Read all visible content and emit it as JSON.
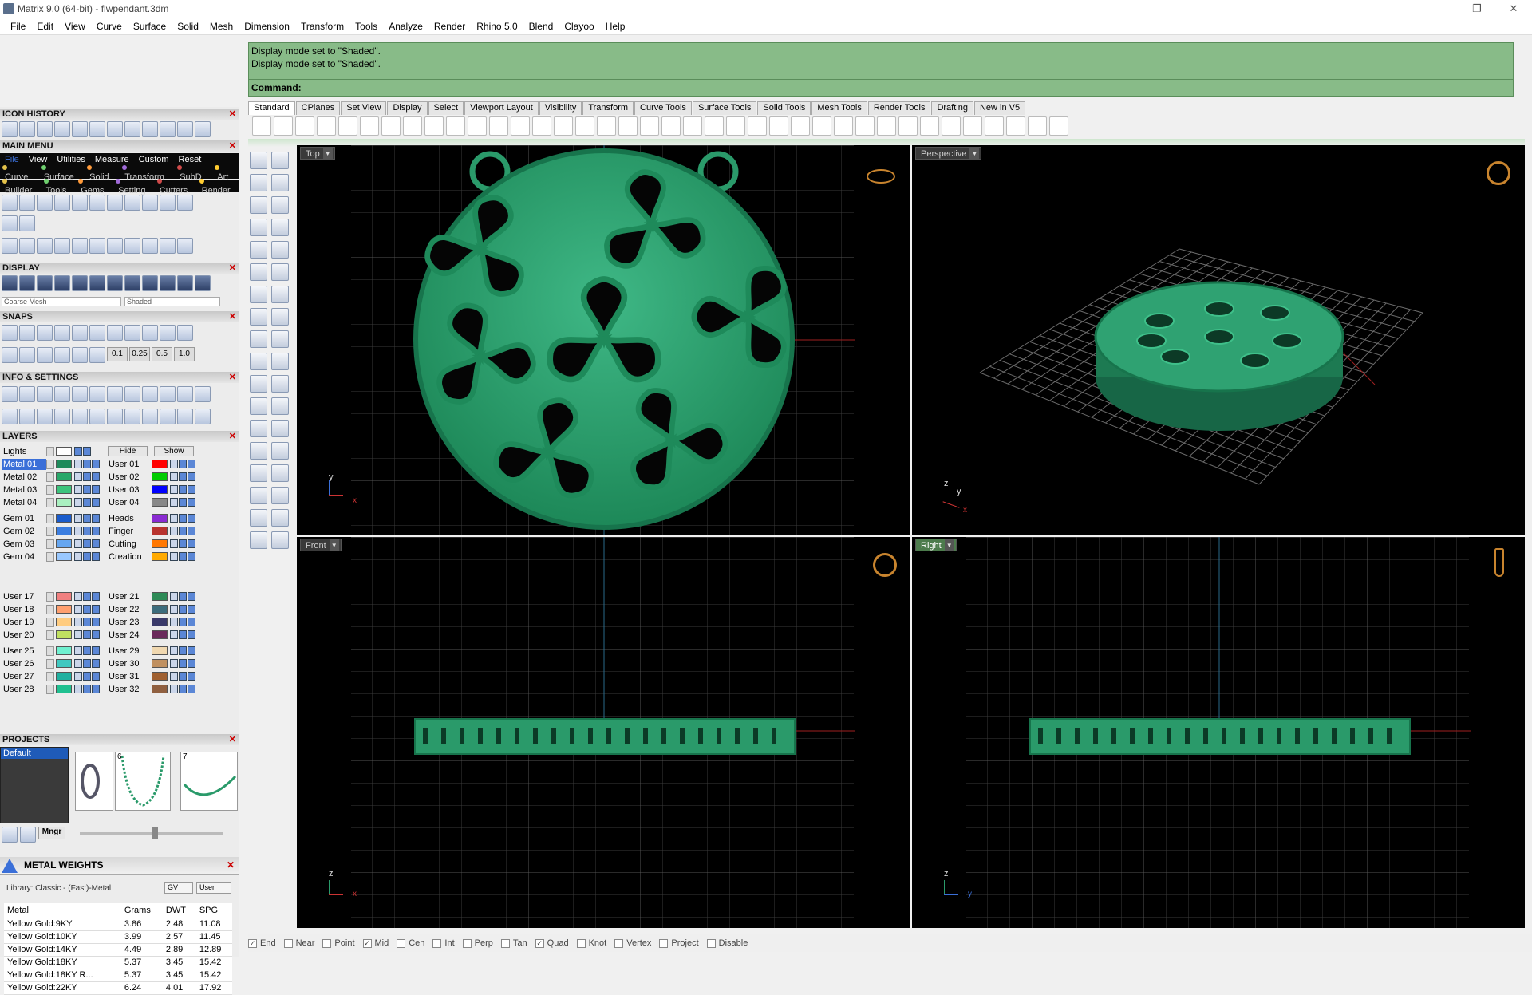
{
  "window": {
    "title": "Matrix 9.0 (64-bit) - flwpendant.3dm",
    "controls": [
      "—",
      "❐",
      "✕"
    ]
  },
  "menu": [
    "File",
    "Edit",
    "View",
    "Curve",
    "Surface",
    "Solid",
    "Mesh",
    "Dimension",
    "Transform",
    "Tools",
    "Analyze",
    "Render",
    "Rhino 5.0",
    "Blend",
    "Clayoo",
    "Help"
  ],
  "command": {
    "history": [
      "Display mode set to \"Shaded\".",
      "Display mode set to \"Shaded\"."
    ],
    "prompt": "Command:"
  },
  "toolbar_tabs": [
    "Standard",
    "CPlanes",
    "Set View",
    "Display",
    "Select",
    "Viewport Layout",
    "Visibility",
    "Transform",
    "Curve Tools",
    "Surface Tools",
    "Solid Tools",
    "Mesh Tools",
    "Render Tools",
    "Drafting",
    "New in V5"
  ],
  "panels": {
    "icon_history": "ICON HISTORY",
    "main_menu": "MAIN MENU",
    "main_menu_tabs": [
      "File",
      "View",
      "Utilities",
      "Measure",
      "Custom",
      "Reset"
    ],
    "main_menu_row1": [
      "Curve",
      "Surface",
      "Solid",
      "Transform",
      "SubD",
      "Art"
    ],
    "main_menu_row2": [
      "Builder",
      "Tools",
      "Gems",
      "Setting",
      "Cutters",
      "Render"
    ],
    "display": "DISPLAY",
    "display_mesh": "Coarse Mesh",
    "display_mode": "Shaded",
    "snaps": "SNAPS",
    "snap_values": [
      "0.1",
      "0.25",
      "0.5",
      "1.0"
    ],
    "info_settings": "INFO & SETTINGS",
    "layers": "LAYERS",
    "lights": "Lights",
    "hide": "Hide",
    "show": "Show",
    "projects": "PROJECTS",
    "project_default": "Default",
    "project_nums": [
      "6",
      "7"
    ],
    "mngr": "Mngr",
    "metal_weights": "METAL WEIGHTS",
    "library": "Library: Classic - (Fast)-Metal",
    "gv": "GV",
    "user": "User"
  },
  "layers": [
    {
      "l": "Metal 01",
      "lc": "#1e8a5a",
      "r": "User 01",
      "rc": "#ff0000",
      "sel": true
    },
    {
      "l": "Metal 02",
      "lc": "#28a86a",
      "r": "User 02",
      "rc": "#00cc00"
    },
    {
      "l": "Metal 03",
      "lc": "#3cc47c",
      "r": "User 03",
      "rc": "#0000ff"
    },
    {
      "l": "Metal 04",
      "lc": "#aaf0c0",
      "r": "User 04",
      "rc": "#888888"
    },
    {
      "l": "Gem 01",
      "lc": "#1a5ccc",
      "r": "Heads",
      "rc": "#8a2bd2"
    },
    {
      "l": "Gem 02",
      "lc": "#3c7ee0",
      "r": "Finger",
      "rc": "#b8332e"
    },
    {
      "l": "Gem 03",
      "lc": "#66a6f0",
      "r": "Cutting",
      "rc": "#ff7700"
    },
    {
      "l": "Gem 04",
      "lc": "#99c8ff",
      "r": "Creation",
      "rc": "#ffaa00"
    },
    {
      "l": "User 17",
      "lc": "#f08080",
      "r": "User 21",
      "rc": "#2e8b57"
    },
    {
      "l": "User 18",
      "lc": "#ffa070",
      "r": "User 22",
      "rc": "#3c6c7c"
    },
    {
      "l": "User 19",
      "lc": "#ffcc80",
      "r": "User 23",
      "rc": "#3a3a6a"
    },
    {
      "l": "User 20",
      "lc": "#c0e060",
      "r": "User 24",
      "rc": "#6a2a5a"
    },
    {
      "l": "User 25",
      "lc": "#70f0d0",
      "r": "User 29",
      "rc": "#f0d8b0"
    },
    {
      "l": "User 26",
      "lc": "#40c8c0",
      "r": "User 30",
      "rc": "#c09060"
    },
    {
      "l": "User 27",
      "lc": "#20b0a0",
      "r": "User 31",
      "rc": "#a06030"
    },
    {
      "l": "User 28",
      "lc": "#20c090",
      "r": "User 32",
      "rc": "#906040"
    }
  ],
  "metal_table": {
    "headers": [
      "Metal",
      "Grams",
      "DWT",
      "SPG"
    ],
    "rows": [
      [
        "Yellow Gold:9KY",
        "3.86",
        "2.48",
        "11.08"
      ],
      [
        "Yellow Gold:10KY",
        "3.99",
        "2.57",
        "11.45"
      ],
      [
        "Yellow Gold:14KY",
        "4.49",
        "2.89",
        "12.89"
      ],
      [
        "Yellow Gold:18KY",
        "5.37",
        "3.45",
        "15.42"
      ],
      [
        "Yellow Gold:18KY R...",
        "5.37",
        "3.45",
        "15.42"
      ],
      [
        "Yellow Gold:22KY",
        "6.24",
        "4.01",
        "17.92"
      ]
    ]
  },
  "viewports": {
    "top": "Top",
    "perspective": "Perspective",
    "front": "Front",
    "right": "Right"
  },
  "axes": {
    "x": "x",
    "y": "y",
    "z": "z"
  },
  "osnaps": [
    {
      "label": "End",
      "checked": true
    },
    {
      "label": "Near",
      "checked": false
    },
    {
      "label": "Point",
      "checked": false
    },
    {
      "label": "Mid",
      "checked": true
    },
    {
      "label": "Cen",
      "checked": false
    },
    {
      "label": "Int",
      "checked": false
    },
    {
      "label": "Perp",
      "checked": false
    },
    {
      "label": "Tan",
      "checked": false
    },
    {
      "label": "Quad",
      "checked": true
    },
    {
      "label": "Knot",
      "checked": false
    },
    {
      "label": "Vertex",
      "checked": false
    },
    {
      "label": "Project",
      "checked": false
    },
    {
      "label": "Disable",
      "checked": false
    }
  ],
  "colors": {
    "model": "#2a9a6a",
    "model_dark": "#176646",
    "cmd_bg": "#88bb88"
  }
}
